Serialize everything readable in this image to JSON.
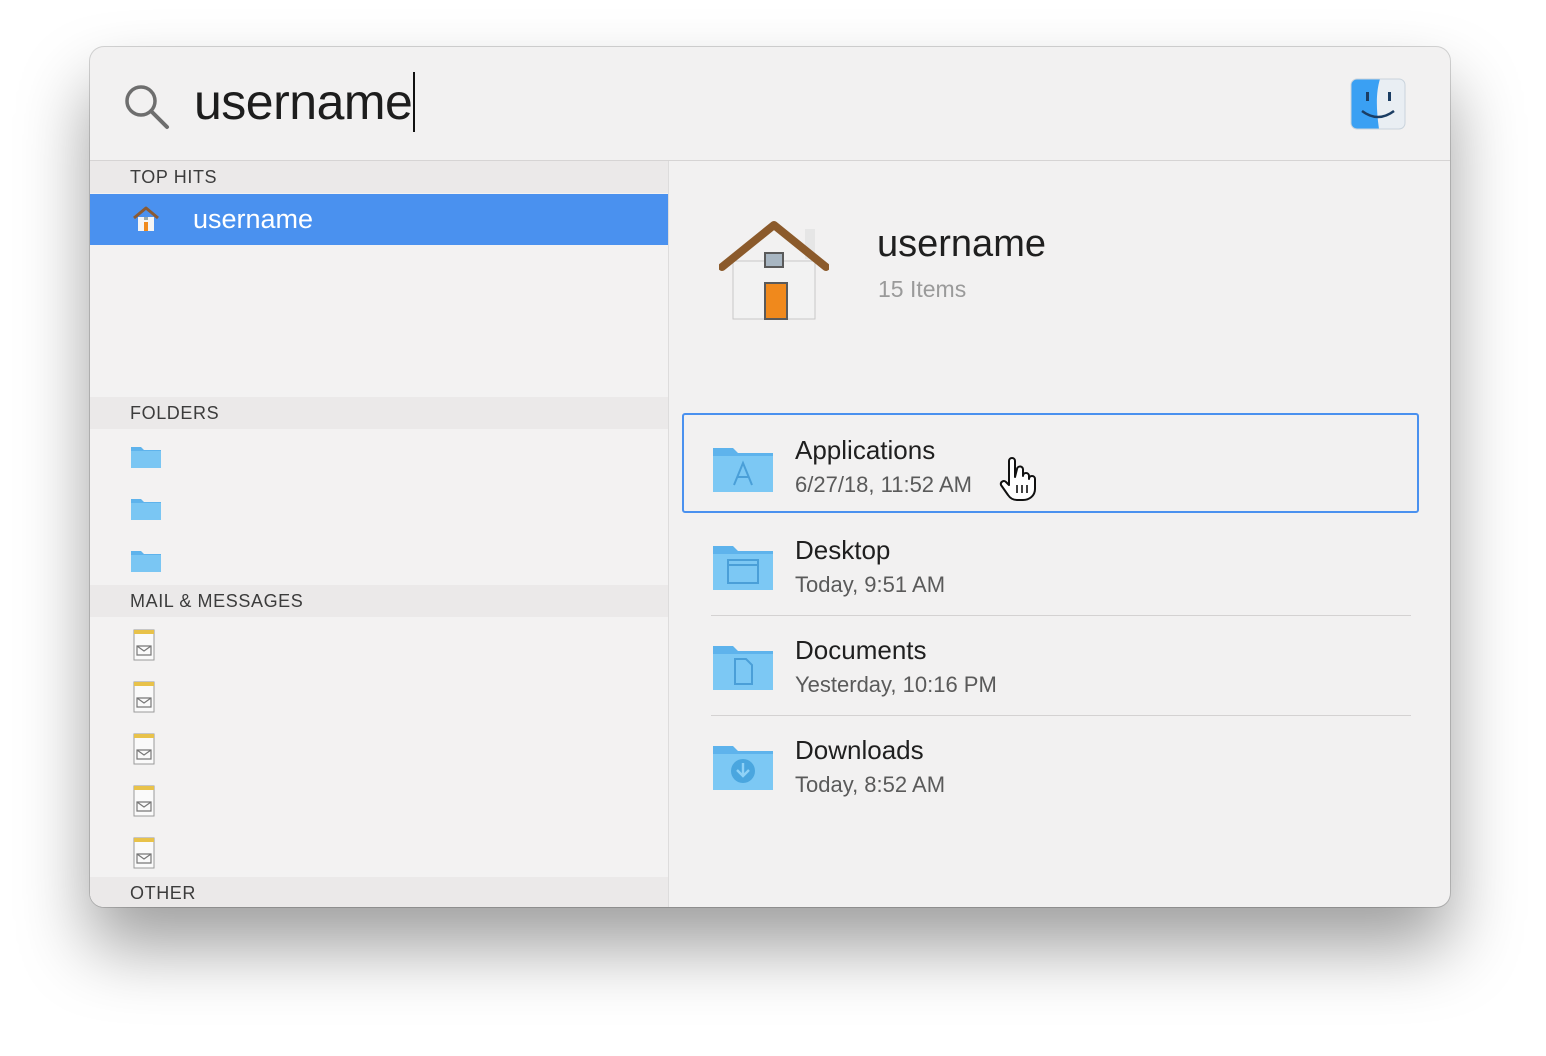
{
  "search": {
    "query": "username"
  },
  "sections": {
    "top_hits": "TOP HITS",
    "folders": "FOLDERS",
    "mail": "MAIL & MESSAGES",
    "other": "OTHER"
  },
  "top_hit": {
    "label": "username",
    "icon": "home-icon"
  },
  "preview": {
    "title": "username",
    "subtitle": "15 Items",
    "items": [
      {
        "name": "Applications",
        "date": "6/27/18, 11:52 AM",
        "icon": "applications-folder-icon"
      },
      {
        "name": "Desktop",
        "date": "Today, 9:51 AM",
        "icon": "desktop-folder-icon"
      },
      {
        "name": "Documents",
        "date": "Yesterday, 10:16 PM",
        "icon": "documents-folder-icon"
      },
      {
        "name": "Downloads",
        "date": "Today, 8:52 AM",
        "icon": "downloads-folder-icon"
      }
    ]
  },
  "colors": {
    "selection": "#4a91ef",
    "folder": "#6cbdf0"
  }
}
